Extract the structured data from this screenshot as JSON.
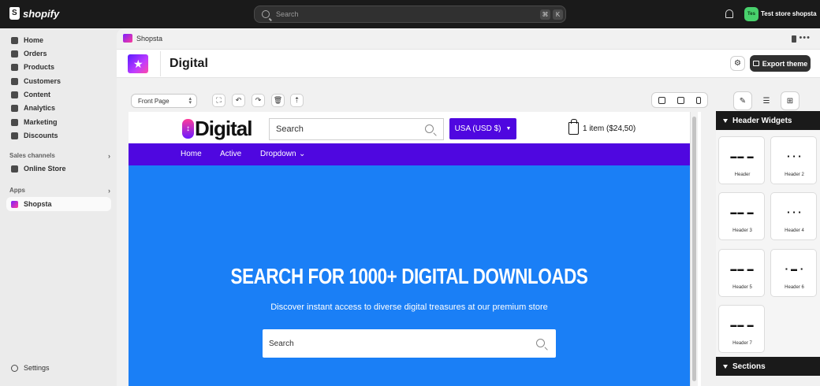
{
  "topbar": {
    "logo_text": "shopify",
    "search_placeholder": "Search",
    "kbd1": "⌘",
    "kbd2": "K",
    "store_initials": "Tes",
    "store_name": "Test store shopsta"
  },
  "sidebar": {
    "items": [
      {
        "label": "Home",
        "icon": "home-icon"
      },
      {
        "label": "Orders",
        "icon": "inbox-icon"
      },
      {
        "label": "Products",
        "icon": "tag-icon"
      },
      {
        "label": "Customers",
        "icon": "person-icon"
      },
      {
        "label": "Content",
        "icon": "content-icon"
      },
      {
        "label": "Analytics",
        "icon": "chart-icon"
      },
      {
        "label": "Marketing",
        "icon": "target-icon"
      },
      {
        "label": "Discounts",
        "icon": "discount-icon"
      }
    ],
    "sales_channels_label": "Sales channels",
    "online_store": "Online Store",
    "apps_label": "Apps",
    "app_shopsta": "Shopsta",
    "settings": "Settings"
  },
  "breadcrumb": {
    "title": "Shopsta"
  },
  "header": {
    "title": "Digital",
    "export_label": "Export theme"
  },
  "toolbar": {
    "page_select": "Front Page"
  },
  "preview": {
    "logo_text": "Digital",
    "search_placeholder": "Search",
    "currency": "USA (USD $)",
    "cart": "1 item ($24,50)",
    "nav": [
      "Home",
      "Active",
      "Dropdown"
    ],
    "hero_title": "SEARCH FOR 1000+ DIGITAL DOWNLOADS",
    "hero_sub": "Discover instant access to diverse digital treasures at our premium store",
    "hero_search": "Search"
  },
  "right_panel": {
    "header_widgets": "Header Widgets",
    "sections": "Sections",
    "widgets": [
      "Header",
      "Header 2",
      "Header 3",
      "Header 4",
      "Header 5",
      "Header 6",
      "Header 7"
    ]
  },
  "colors": {
    "accent": "#4f07e0",
    "hero": "#1a7ff6",
    "topbar": "#1a1a1a"
  }
}
